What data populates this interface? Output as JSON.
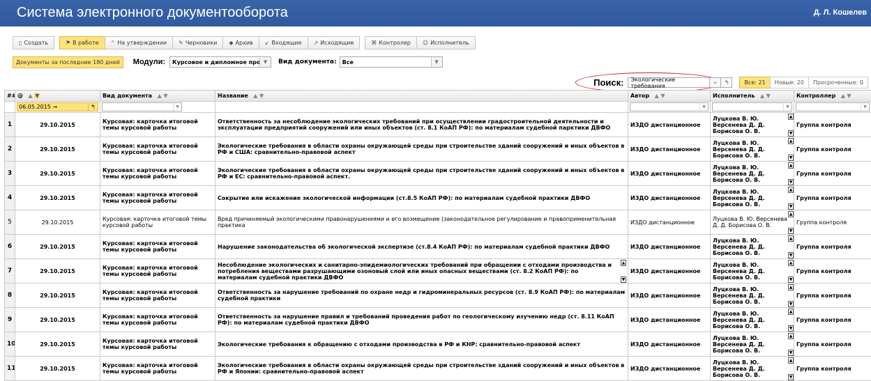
{
  "app": {
    "title": "Система электронного документооборота",
    "user": "Д. Л. Кошелев"
  },
  "toolbar": [
    {
      "icon": "document-icon",
      "glyph": "▯",
      "label": "Создать",
      "active": false,
      "gap": false
    },
    {
      "icon": "flag-icon",
      "glyph": "⚑",
      "label": "В работе",
      "active": true,
      "gap": true
    },
    {
      "icon": "chevron-up-icon",
      "glyph": "^",
      "label": "На утверждении",
      "active": false,
      "gap": false
    },
    {
      "icon": "pencil-icon",
      "glyph": "✎",
      "label": "Черновики",
      "active": false,
      "gap": false
    },
    {
      "icon": "tag-icon",
      "glyph": "◆",
      "label": "Архив",
      "active": false,
      "gap": false
    },
    {
      "icon": "incoming-icon",
      "glyph": "↙",
      "label": "Входящие",
      "active": false,
      "gap": false
    },
    {
      "icon": "outgoing-icon",
      "glyph": "↗",
      "label": "Исходящие",
      "active": false,
      "gap": false
    },
    {
      "icon": "controller-icon",
      "glyph": "⌘",
      "label": "Контролер",
      "active": false,
      "gap": true
    },
    {
      "icon": "executor-icon",
      "glyph": "☺",
      "label": "Исполнитель",
      "active": false,
      "gap": false
    }
  ],
  "filters": {
    "days_label": "Документы за последние 180 дней",
    "modules_label": "Модули:",
    "modules_value": "Курсовое и дипломное проє",
    "doctype_label": "Вид документа:",
    "doctype_value": "Все"
  },
  "search": {
    "label": "Поиск:",
    "value": "Экологические требования",
    "counters": [
      {
        "label": "Все: 21",
        "active": true
      },
      {
        "label": "Новые: 20",
        "active": false
      },
      {
        "label": "Просроченные: 0",
        "active": false
      }
    ]
  },
  "table": {
    "headers": {
      "num": "##",
      "date": "@",
      "type": "Вид документа",
      "name": "Название",
      "author": "Автор",
      "executor": "Исполнитель",
      "controller": "Контроллер"
    },
    "date_filter": "06.05.2015 →",
    "rows": [
      {
        "n": "1",
        "date": "29.10.2015",
        "type": "Курсовая: карточка итоговой темы курсовой работы",
        "name": "Ответственность за несоблюдение экологических требований при осуществлении градостроительной деятельности и эксплуатации предприятий сооружений или иных объектов (ст. 8.1 КоАП РФ): по материалам судебной парктики ДВФО",
        "author": "ИЗДО дистанционное",
        "executor": "Луцкова В. Ю. Версенева Д. Д. Борисова О. В.",
        "controller": "Группа контроля",
        "bold": true,
        "scroll": false
      },
      {
        "n": "2",
        "date": "29.10.2015",
        "type": "Курсовая: карточка итоговой темы курсовой работы",
        "name": "Экологические требования в области охраны окружающей среды при строительстве зданий сооружений и иных объектов в РФ и США: сравнительно-правовой аспект",
        "author": "ИЗДО дистанционное",
        "executor": "Луцкова В. Ю. Версенева Д. Д. Борисова О. В.",
        "controller": "Группа контроля",
        "bold": true,
        "scroll": false
      },
      {
        "n": "3",
        "date": "29.10.2015",
        "type": "Курсовая: карточка итоговой темы курсовой работы",
        "name": "Экологические требования в области охраны окружающей среды при строительстве зданий сооружений и иных объектов в РФ и ЕС: сравнительно-правовой аспект.",
        "author": "ИЗДО дистанционное",
        "executor": "Луцкова В. Ю. Версенева Д. Д. Борисова О. В.",
        "controller": "Группа контроля",
        "bold": true,
        "scroll": false
      },
      {
        "n": "4",
        "date": "29.10.2015",
        "type": "Курсовая: карточка итоговой темы курсовой работы",
        "name": "Сокрытие или искажение экологической информации (ст.8.5 КоАП РФ): по материалам судебной практики ДВФО",
        "author": "ИЗДО дистанционное",
        "executor": "Луцкова В. Ю. Версенева Д. Д. Борисова О. В.",
        "controller": "Группа контроля",
        "bold": true,
        "scroll": false
      },
      {
        "n": "5",
        "date": "29.10.2015",
        "type": "Курсовая: карточка итоговой темы курсовой работы",
        "name": "Вред причиняемый экологическими правонарушениями и его возмещение (законодательное регулирование и правоприменительная практика",
        "author": "ИЗДО дистанционное",
        "executor": "Луцкова В. Ю. Версенева Д. Д. Борисова О. В.",
        "controller": "Группа контроля",
        "bold": false,
        "scroll": false
      },
      {
        "n": "6",
        "date": "29.10.2015",
        "type": "Курсовая: карточка итоговой темы курсовой работы",
        "name": "Нарушение законодательства об экологической экспертизе (ст.8.4 КоАП РФ): по материалам судебной практики ДВФО",
        "author": "ИЗДО дистанционное",
        "executor": "Луцкова В. Ю. Версенева Д. Д. Борисова О. В.",
        "controller": "Группа контроля",
        "bold": true,
        "scroll": false
      },
      {
        "n": "7",
        "date": "29.10.2015",
        "type": "Курсовая: карточка итоговой темы курсовой работы",
        "name": "Несоблюдение экологических и санитарно-эпидемиологических требований при обращении с отходами производства и потребления веществами разрушающими озоновый слой или иных опасных веществами (ст. 8.2 КоАП РФ): по материалам судебной практики ДВФО",
        "author": "ИЗДО дистанционное",
        "executor": "Луцкова В. Ю. Версенева Д. Д. Борисова О. В.",
        "controller": "Группа контроля",
        "bold": true,
        "scroll": true
      },
      {
        "n": "8",
        "date": "29.10.2015",
        "type": "Курсовая: карточка итоговой темы курсовой работы",
        "name": "Ответственность за нарушение требований по охране недр и гидроминеральных ресурсов (ст. 8.9 КоАП РФ): по материалам судебной практики",
        "author": "ИЗДО дистанционное",
        "executor": "Луцкова В. Ю. Версенева Д. Д. Борисова О. В.",
        "controller": "Группа контроля",
        "bold": true,
        "scroll": false
      },
      {
        "n": "9",
        "date": "29.10.2015",
        "type": "Курсовая: карточка итоговой темы курсовой работы",
        "name": "Ответственность за нарушение правил и требований проведения работ по геологическому изучению недр (ст. 8.11 КоАП РФ): по материалам судебной практики ДВФО",
        "author": "ИЗДО дистанционное",
        "executor": "Луцкова В. Ю. Версенева Д. Д. Борисова О. В.",
        "controller": "Группа контроля",
        "bold": true,
        "scroll": false
      },
      {
        "n": "10",
        "date": "29.10.2015",
        "type": "Курсовая: карточка итоговой темы курсовой работы",
        "name": "Экологические требования к обращению с отходами производства в РФ и КНР: сравнительно-правовой аспект",
        "author": "ИЗДО дистанционное",
        "executor": "Луцкова В. Ю. Версенева Д. Д. Борисова О. В.",
        "controller": "Группа контроля",
        "bold": true,
        "scroll": false
      },
      {
        "n": "11",
        "date": "29.10.2015",
        "type": "Курсовая: карточка итоговой темы курсовой работы",
        "name": "Экологические требования в области охраны окружающей среды при строительстве зданий сооружений и иных объектов в РФ и Японии: сравнительно-правовой аспект",
        "author": "ИЗДО дистанционное",
        "executor": "Луцкова В. Ю. Версенева Д. Д. Борисова О. В.",
        "controller": "Группа контроля",
        "bold": true,
        "scroll": false
      }
    ]
  }
}
